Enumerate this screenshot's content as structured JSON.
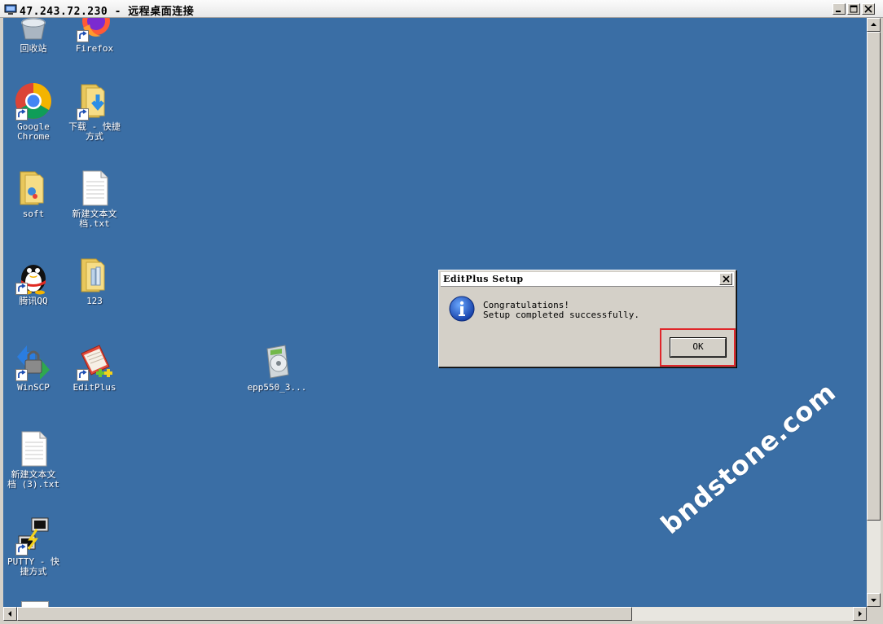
{
  "window": {
    "title": "47.243.72.230 - 远程桌面连接"
  },
  "desktop": {
    "background": "#3a6ea5",
    "icons": [
      {
        "label": "回收站",
        "icon": "recycle-bin-icon",
        "shortcut": false
      },
      {
        "label": "Firefox",
        "icon": "firefox-icon",
        "shortcut": true
      },
      {
        "label": "Google\nChrome",
        "icon": "chrome-icon",
        "shortcut": true
      },
      {
        "label": "下载 - 快捷\n方式",
        "icon": "downloads-folder-icon",
        "shortcut": true
      },
      {
        "label": "soft",
        "icon": "folder-icon",
        "shortcut": false
      },
      {
        "label": "新建文本文\n档.txt",
        "icon": "text-file-icon",
        "shortcut": false
      },
      {
        "label": "腾讯QQ",
        "icon": "qq-icon",
        "shortcut": true
      },
      {
        "label": "123",
        "icon": "folder-icon",
        "shortcut": false
      },
      {
        "label": "WinSCP",
        "icon": "winscp-icon",
        "shortcut": true
      },
      {
        "label": "EditPlus",
        "icon": "editplus-icon",
        "shortcut": true
      },
      {
        "label": "epp550_3...",
        "icon": "installer-icon",
        "shortcut": false
      },
      {
        "label": "新建文本文\n档 (3).txt",
        "icon": "text-file-icon",
        "shortcut": false
      },
      {
        "label": "PUTTY - 快\n捷方式",
        "icon": "putty-icon",
        "shortcut": true
      }
    ]
  },
  "dialog": {
    "title": "EditPlus Setup",
    "message_line1": "Congratulations!",
    "message_line2": "Setup completed successfully.",
    "ok_label": "OK",
    "icon": "info-icon",
    "highlight_color": "#e0262a"
  },
  "watermark": "bndstone.com"
}
